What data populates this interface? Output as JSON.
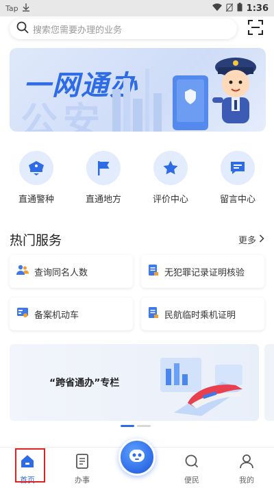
{
  "status_bar": {
    "carrier": "Tap",
    "time": "1:36"
  },
  "search": {
    "placeholder": "搜索您需要办理的业务"
  },
  "banner": {
    "title": "一网通办",
    "bg_text": "公安"
  },
  "quick_actions": [
    {
      "label": "直通警种",
      "icon": "police-cap-icon"
    },
    {
      "label": "直通地方",
      "icon": "flag-icon"
    },
    {
      "label": "评价中心",
      "icon": "star-icon"
    },
    {
      "label": "留言中心",
      "icon": "message-icon"
    }
  ],
  "hot_services": {
    "title": "热门服务",
    "more": "更多",
    "items": [
      {
        "label": "查询同名人数",
        "icon": "people-icon"
      },
      {
        "label": "无犯罪记录证明核验",
        "icon": "document-icon"
      },
      {
        "label": "备案机动车",
        "icon": "car-card-icon"
      },
      {
        "label": "民航临时乘机证明",
        "icon": "document-icon"
      }
    ]
  },
  "promo": {
    "text": "“跨省通办”专栏"
  },
  "carousel": {
    "active_index": 0,
    "count": 2
  },
  "tab_bar": {
    "tabs": [
      {
        "label": "首页",
        "icon": "home-icon"
      },
      {
        "label": "办事",
        "icon": "document-icon"
      },
      {
        "label": "",
        "icon": "robot-icon"
      },
      {
        "label": "便民",
        "icon": "search-icon"
      },
      {
        "label": "我的",
        "icon": "user-icon"
      }
    ],
    "active_index": 0
  },
  "colors": {
    "accent": "#2e6be6",
    "highlight_border": "#e02020"
  }
}
